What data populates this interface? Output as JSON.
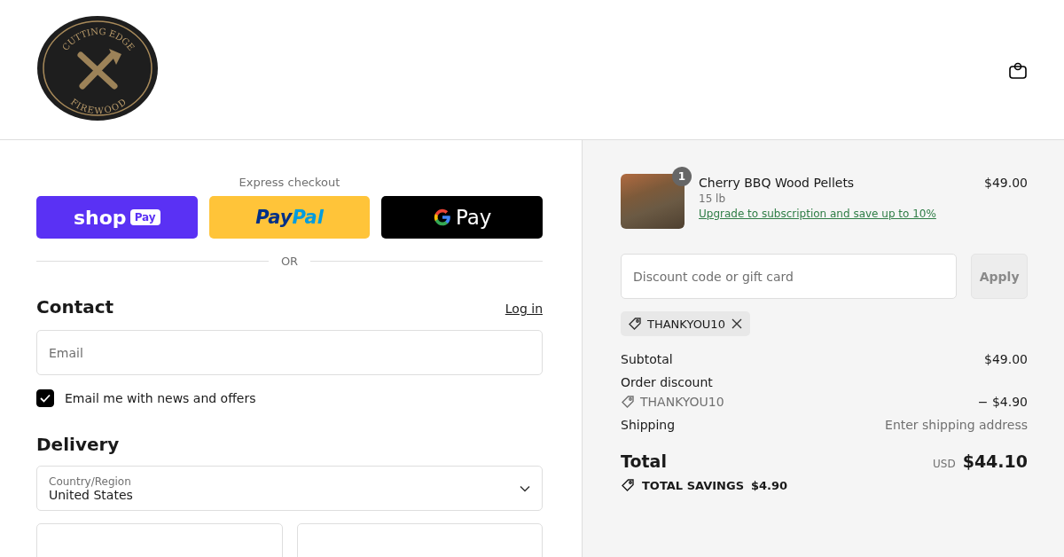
{
  "header": {
    "logo": {
      "top_text": "CUTTING EDGE",
      "bottom_text": "FIREWOOD"
    }
  },
  "express_checkout": {
    "title": "Express checkout",
    "buttons": [
      {
        "kind": "shoppay",
        "label": "shop",
        "badge": "Pay"
      },
      {
        "kind": "paypal",
        "label": "Pay",
        "label_2": "Pal"
      },
      {
        "kind": "gpay",
        "label": "Pay"
      }
    ],
    "divider": "OR"
  },
  "contact": {
    "title": "Contact",
    "login_link": "Log in",
    "email": {
      "placeholder": "Email"
    },
    "newsletter": {
      "label": "Email me with news and offers",
      "checked": true
    }
  },
  "delivery": {
    "title": "Delivery",
    "country": {
      "label": "Country/Region",
      "value": "United States"
    }
  },
  "summary": {
    "item": {
      "quantity": "1",
      "name": "Cherry BBQ Wood Pellets",
      "variant": "15 lb",
      "upgrade_link": "Upgrade to subscription and save up to 10%",
      "price": "$49.00"
    },
    "discount": {
      "placeholder": "Discount code or gift card",
      "button": "Apply",
      "applied_code": "THANKYOU10"
    },
    "lines": [
      {
        "kind": "plain",
        "label": "Subtotal",
        "value": "$49.00"
      },
      {
        "kind": "discount",
        "label": "Order discount",
        "code": "THANKYOU10",
        "value": "− $4.90"
      },
      {
        "kind": "muted",
        "label": "Shipping",
        "value": "Enter shipping address"
      }
    ],
    "total": {
      "label": "Total",
      "currency": "USD",
      "value": "$44.10"
    },
    "savings": {
      "label": "TOTAL SAVINGS",
      "value": "$4.90"
    }
  }
}
